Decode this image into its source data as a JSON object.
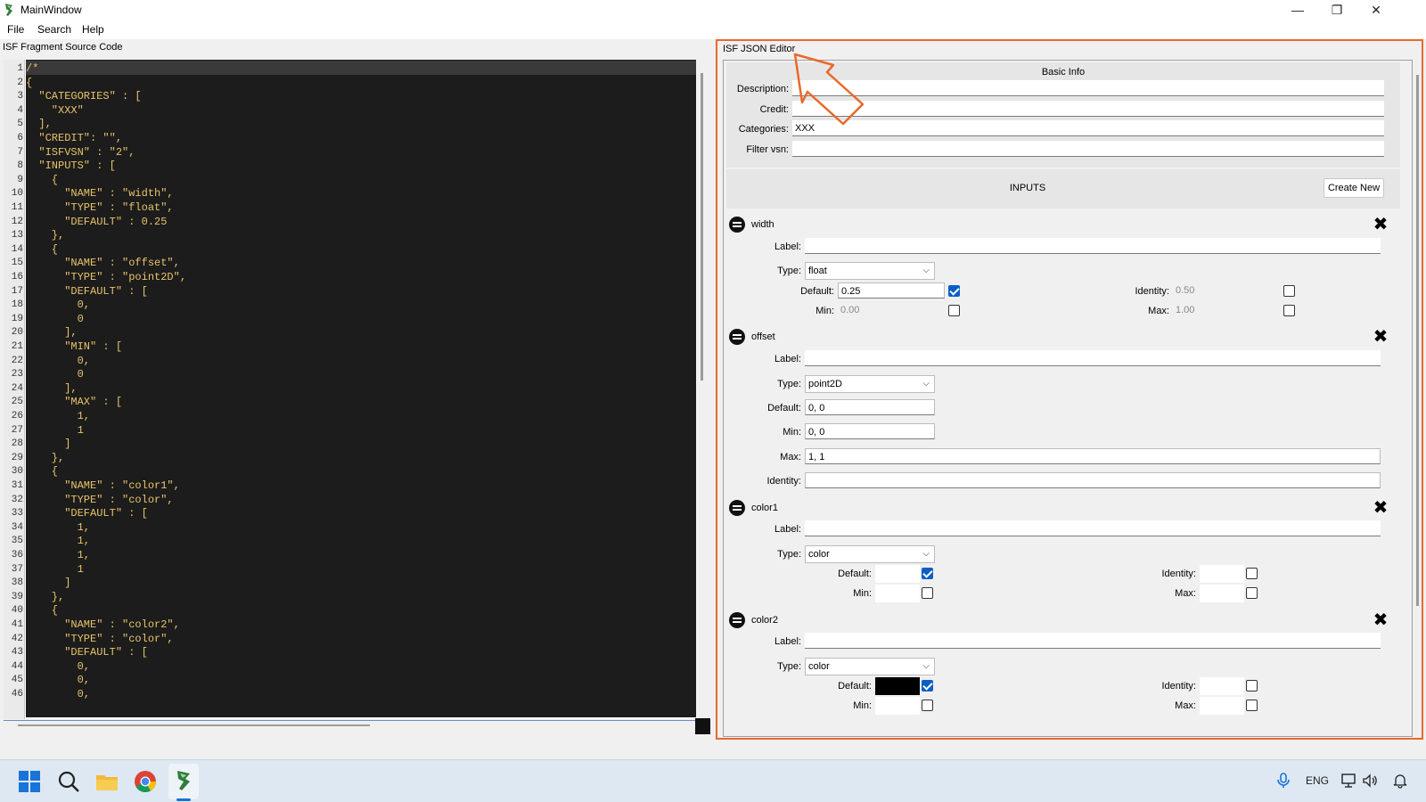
{
  "window": {
    "title": "MainWindow",
    "minimize": "—",
    "restore": "❐",
    "close": "✕"
  },
  "menu": [
    "File",
    "Search",
    "Help"
  ],
  "left_pane": {
    "label": "ISF Fragment Source Code",
    "line_numbers": [
      "1",
      "2",
      "3",
      "4",
      "5",
      "6",
      "7",
      "8",
      "9",
      "10",
      "11",
      "12",
      "13",
      "14",
      "15",
      "16",
      "17",
      "18",
      "19",
      "20",
      "21",
      "22",
      "23",
      "24",
      "25",
      "26",
      "27",
      "28",
      "29",
      "30",
      "31",
      "32",
      "33",
      "34",
      "35",
      "36",
      "37",
      "38",
      "39",
      "40",
      "41",
      "42",
      "43",
      "44",
      "45",
      "46"
    ],
    "code_lines": [
      "/*",
      "{",
      "  \"CATEGORIES\" : [",
      "    \"XXX\"",
      "  ],",
      "  \"CREDIT\": \"\",",
      "  \"ISFVSN\" : \"2\",",
      "  \"INPUTS\" : [",
      "    {",
      "      \"NAME\" : \"width\",",
      "      \"TYPE\" : \"float\",",
      "      \"DEFAULT\" : 0.25",
      "    },",
      "    {",
      "      \"NAME\" : \"offset\",",
      "      \"TYPE\" : \"point2D\",",
      "      \"DEFAULT\" : [",
      "        0,",
      "        0",
      "      ],",
      "      \"MIN\" : [",
      "        0,",
      "        0",
      "      ],",
      "      \"MAX\" : [",
      "        1,",
      "        1",
      "      ]",
      "    },",
      "    {",
      "      \"NAME\" : \"color1\",",
      "      \"TYPE\" : \"color\",",
      "      \"DEFAULT\" : [",
      "        1,",
      "        1,",
      "        1,",
      "        1",
      "      ]",
      "    },",
      "    {",
      "      \"NAME\" : \"color2\",",
      "      \"TYPE\" : \"color\",",
      "      \"DEFAULT\" : [",
      "        0,",
      "        0,",
      "        0,"
    ]
  },
  "right_pane": {
    "label": "ISF JSON Editor",
    "basic_info": {
      "title": "Basic Info",
      "description_label": "Description:",
      "description_value": "",
      "credit_label": "Credit:",
      "credit_value": "",
      "categories_label": "Categories:",
      "categories_value": "XXX",
      "filter_vsn_label": "Filter vsn:",
      "filter_vsn_value": ""
    },
    "inputs": {
      "title": "INPUTS",
      "create_new_label": "Create New"
    },
    "labels": {
      "label": "Label:",
      "type": "Type:",
      "default": "Default:",
      "min": "Min:",
      "max": "Max:",
      "identity": "Identity:"
    },
    "width_input": {
      "name": "width",
      "type": "float",
      "default": "0.25",
      "identity": "0.50",
      "min": "0.00",
      "max": "1.00",
      "default_checked": true,
      "identity_checked": false,
      "min_checked": false,
      "max_checked": false
    },
    "offset_input": {
      "name": "offset",
      "type": "point2D",
      "default": "0, 0",
      "min": "0, 0",
      "max": "1, 1",
      "identity": ""
    },
    "color1_input": {
      "name": "color1",
      "type": "color",
      "default_color": "#ffffff",
      "default_checked": true,
      "identity_checked": false,
      "min_checked": false,
      "max_checked": false
    },
    "color2_input": {
      "name": "color2",
      "type": "color",
      "default_color": "#000000",
      "default_checked": true,
      "identity_checked": false,
      "min_checked": false,
      "max_checked": false
    }
  },
  "taskbar": {
    "lang": "ENG"
  },
  "colors": {
    "highlight_border": "#e8692a",
    "code_background": "#1c1c1c",
    "code_text": "#e8c46a",
    "checkbox_checked": "#0a5fc4"
  }
}
